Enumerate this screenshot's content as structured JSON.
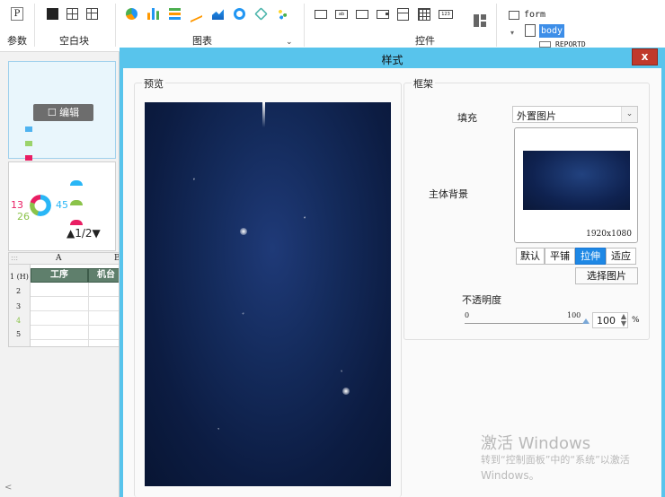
{
  "toolbar": {
    "param_label": "参数",
    "blank_label": "空白块",
    "chart_label": "图表",
    "widget_label": "控件",
    "param_icon_letter": "P"
  },
  "tree": {
    "form_label": "form",
    "body_label": "body",
    "reportd_label": "REPORTD"
  },
  "cards": {
    "edit_label": "编辑",
    "pager_text": "▲1/2▼",
    "donut_values": [
      "13",
      "45",
      "26"
    ]
  },
  "grid": {
    "columns": [
      "A",
      "B"
    ],
    "rows": [
      "1 (H)",
      "2",
      "3",
      "4",
      "5"
    ],
    "header_cells": [
      "工序",
      "机台"
    ]
  },
  "dialog": {
    "title": "样式",
    "close_label": "x",
    "preview_label": "预览",
    "frame_label": "框架",
    "fill_label": "填充",
    "fill_value": "外置图片",
    "main_bg_label": "主体背景",
    "image_size": "1920x1080",
    "mode_buttons": [
      "默认",
      "平铺",
      "拉伸",
      "适应"
    ],
    "active_mode": "拉伸",
    "choose_image_label": "选择图片",
    "opacity_label": "不透明度",
    "opacity_min": "0",
    "opacity_max": "100",
    "opacity_value": "100",
    "opacity_unit": "%"
  },
  "watermark": {
    "line1": "激活 Windows",
    "line2": "转到“控制面板”中的“系统”以激活",
    "line3": "Windows。"
  },
  "colors": {
    "dialog_frame": "#58c4ec",
    "active_mode": "#1e88e5",
    "close": "#c0392b"
  }
}
